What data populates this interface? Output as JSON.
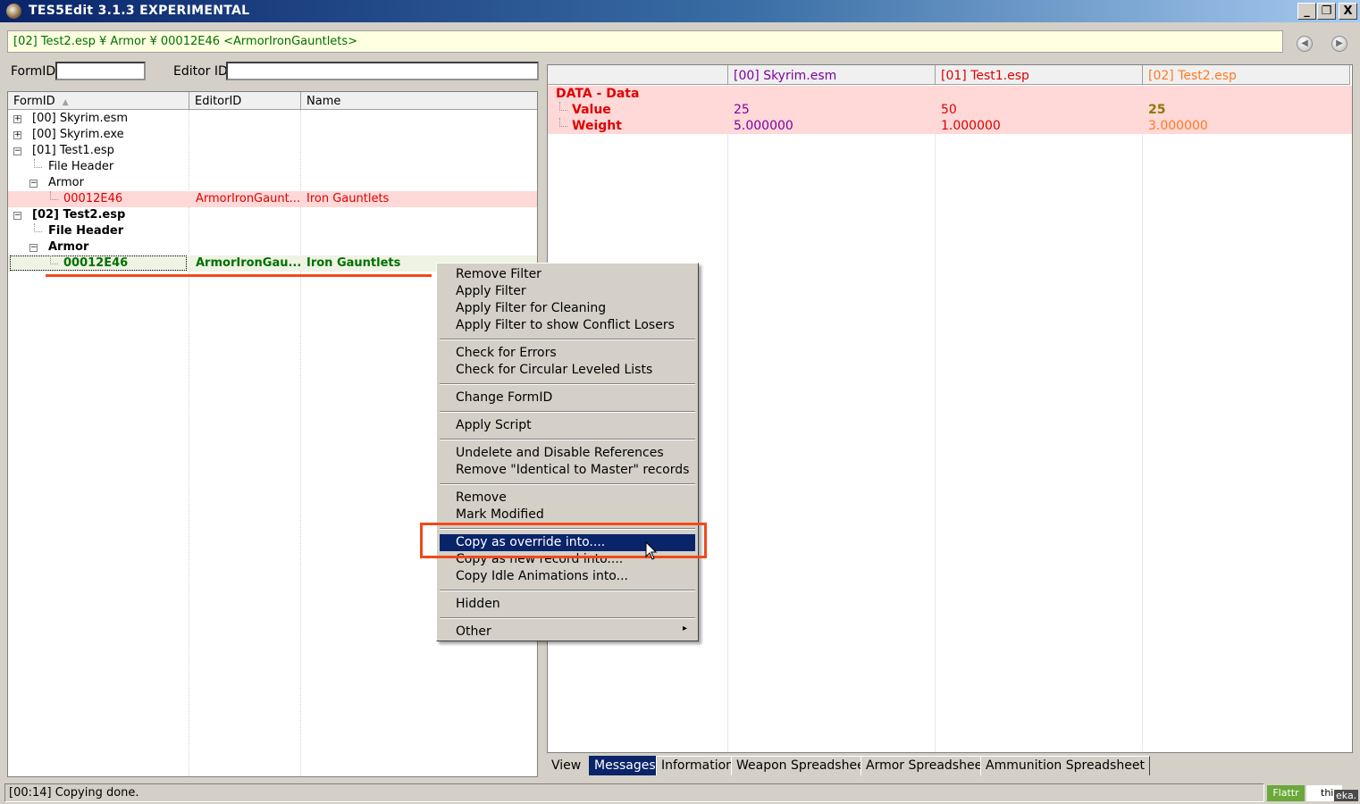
{
  "window": {
    "title": "TES5Edit 3.1.3 EXPERIMENTAL",
    "minimize": "_",
    "restore": "❐",
    "close": "X"
  },
  "path_bar": {
    "text": "[02] Test2.esp ¥ Armor ¥ 00012E46 <ArmorIronGauntlets>"
  },
  "filters": {
    "formid_label": "FormID",
    "editorid_label": "Editor ID",
    "formid_value": "",
    "editorid_value": ""
  },
  "tree": {
    "columns": [
      "FormID",
      "EditorID",
      "Name"
    ],
    "sort_indicator": "▲",
    "rows": [
      {
        "label": "[00] Skyrim.esm",
        "editorid": "",
        "name": ""
      },
      {
        "label": "[00] Skyrim.exe",
        "editorid": "",
        "name": ""
      },
      {
        "label": "[01] Test1.esp",
        "editorid": "",
        "name": ""
      },
      {
        "label": "File Header",
        "editorid": "",
        "name": ""
      },
      {
        "label": "Armor",
        "editorid": "",
        "name": ""
      },
      {
        "label": "00012E46",
        "editorid": "ArmorIronGaunt...",
        "name": "Iron Gauntlets"
      },
      {
        "label": "[02] Test2.esp",
        "editorid": "",
        "name": ""
      },
      {
        "label": "File Header",
        "editorid": "",
        "name": ""
      },
      {
        "label": "Armor",
        "editorid": "",
        "name": ""
      },
      {
        "label": "00012E46",
        "editorid": "ArmorIronGau...",
        "name": "Iron Gauntlets"
      }
    ],
    "expanders": {
      "plus": "+",
      "minus": "−"
    }
  },
  "record_view": {
    "columns": [
      "[00] Skyrim.esm",
      "[01] Test1.esp",
      "[02] Test2.esp"
    ],
    "rows": [
      {
        "label": "DATA - Data",
        "values": [
          "",
          "",
          ""
        ]
      },
      {
        "label": "Value",
        "values": [
          "25",
          "50",
          "25"
        ]
      },
      {
        "label": "Weight",
        "values": [
          "5.000000",
          "1.000000",
          "3.000000"
        ]
      }
    ]
  },
  "tabs": {
    "view_label": "View",
    "items": [
      "Messages",
      "Information",
      "Weapon Spreadsheet",
      "Armor Spreadsheet",
      "Ammunition Spreadsheet"
    ],
    "active": "Messages"
  },
  "status": {
    "message": "[00:14] Copying done.",
    "flattr": "Flattr",
    "this_label": "thi",
    "corner_text": "eka."
  },
  "context_menu": {
    "items": [
      "Remove Filter",
      "Apply Filter",
      "Apply Filter for Cleaning",
      "Apply Filter to show Conflict Losers",
      "Check for Errors",
      "Check for Circular Leveled Lists",
      "Change FormID",
      "Apply Script",
      "Undelete and Disable References",
      "Remove \"Identical to Master\" records",
      "Remove",
      "Mark Modified",
      "Copy as override into....",
      "Copy as new record into....",
      "Copy Idle Animations into...",
      "Hidden",
      "Other"
    ],
    "selected": "Copy as override into....",
    "submenu_arrow": "▸"
  },
  "colors": {
    "title_gradient_start": "#0a246a",
    "menu_highlight": "#0a246a",
    "annotation": "#f04a1a",
    "conflict_bg": "#ffd8d8",
    "override_green": "#007000",
    "conflict_red": "#e00000"
  },
  "icons": {
    "back": "back-arrow-icon",
    "forward": "forward-arrow-icon",
    "cursor": "mouse-cursor-icon"
  }
}
